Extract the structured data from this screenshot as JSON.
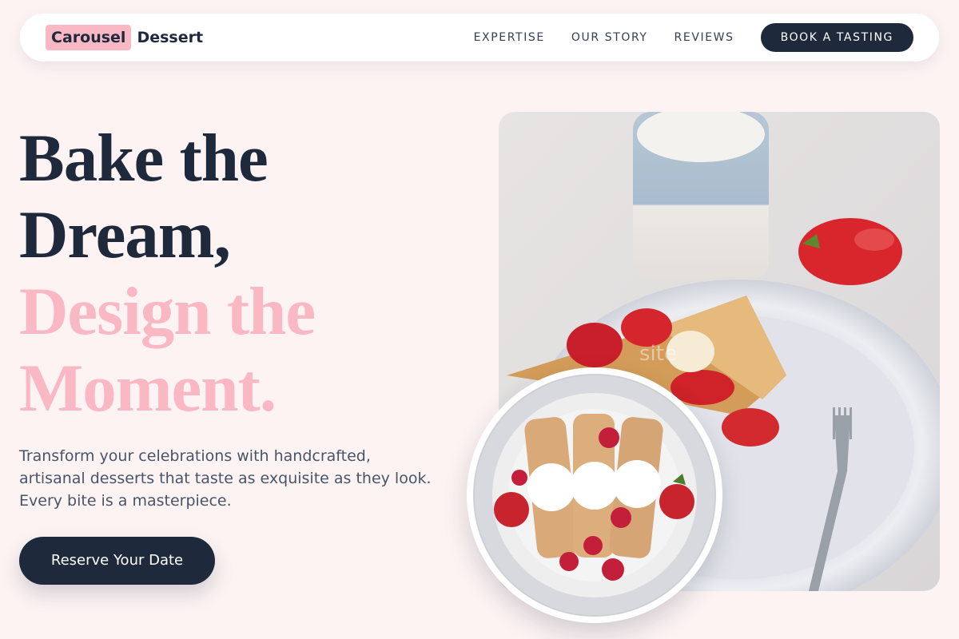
{
  "nav": {
    "logo_highlight": "Carousel",
    "logo_rest": "Dessert",
    "links": [
      "EXPERTISE",
      "OUR STORY",
      "REVIEWS"
    ],
    "cta": "BOOK A TASTING"
  },
  "hero": {
    "title_lines": [
      "Bake the",
      "Dream,"
    ],
    "accent_lines": [
      "Design the",
      "Moment."
    ],
    "subtitle": "Transform your celebrations with handcrafted, artisanal desserts that taste as exquisite as they look. Every bite is a masterpiece.",
    "cta": "Reserve Your Date"
  },
  "images": {
    "main": "crepes-with-strawberries-photo",
    "inset": "crepes-with-cream-and-berries-photo",
    "watermark": "site"
  },
  "colors": {
    "background": "#fdf3f3",
    "navy": "#1e293b",
    "accent_pink": "#f9b8c3"
  }
}
